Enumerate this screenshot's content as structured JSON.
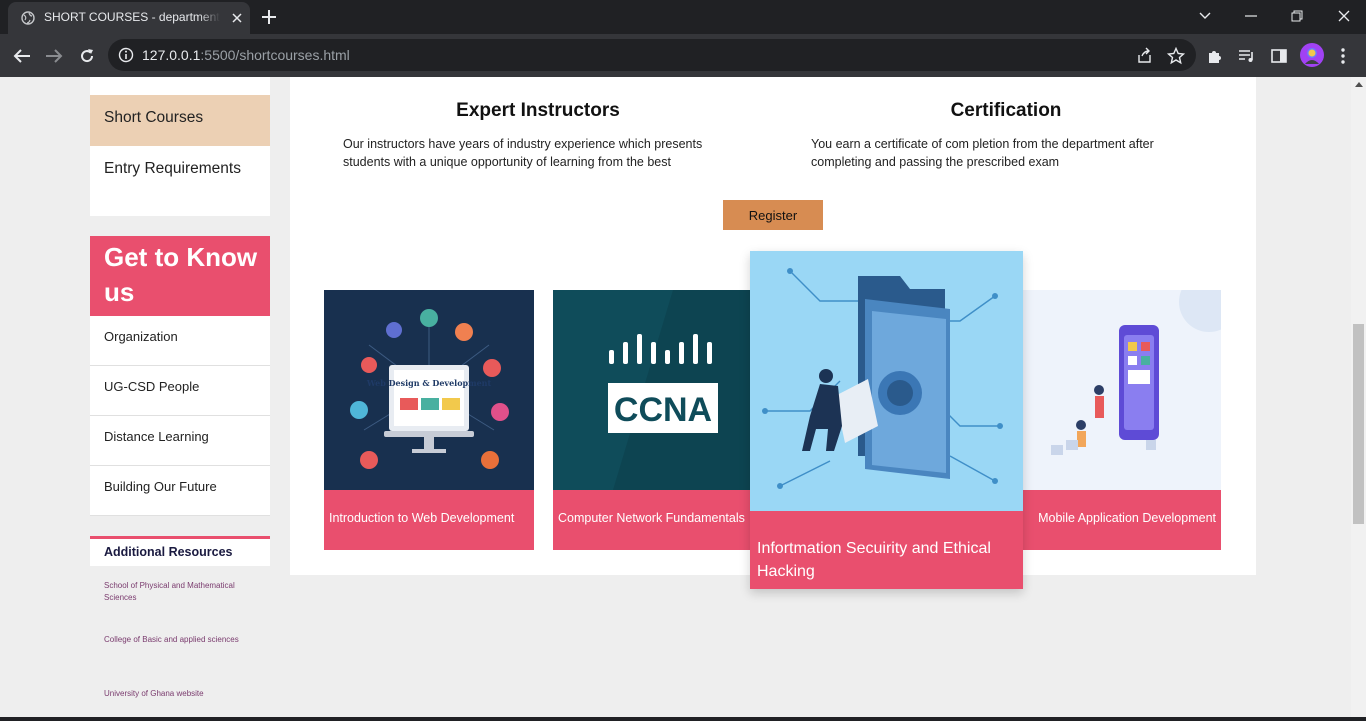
{
  "browser": {
    "tab_title": "SHORT COURSES - department of Computer Science",
    "url_host": "127.0.0.1",
    "url_rest": ":5500/shortcourses.html"
  },
  "sidebar": {
    "top_items": [
      {
        "label": "Short Courses",
        "active": true
      },
      {
        "label": "Entry Requirements",
        "active": false
      }
    ],
    "know_title": "Get to Know us",
    "know_items": [
      "Organization",
      "UG-CSD People",
      "Distance Learning",
      "Building Our Future"
    ],
    "resources_title": "Additional Resources",
    "resources": [
      "School of Physical and Mathematical Sciences",
      "College of Basic and applied sciences",
      "University of Ghana website"
    ]
  },
  "features": [
    {
      "title": "Expert Instructors",
      "text": "Our instructors have years of industry experience which presents students with a unique opportunity of learning from the best"
    },
    {
      "title": "Certification",
      "text": "You earn a certificate of com pletion from the department after completing and passing the prescribed exam"
    }
  ],
  "register_label": "Register",
  "courses": [
    {
      "title": "Introduction to Web Development",
      "image_text": "Web Design & Development"
    },
    {
      "title": "Computer Network Fundamentals",
      "image_text": "CCNA"
    },
    {
      "title": "Infortmation Secuirity and Ethical Hacking"
    },
    {
      "title": "Mobile Application Development"
    }
  ],
  "colors": {
    "accent": "#e94f6e",
    "active": "#ecd0b4",
    "button": "#d78c52"
  }
}
